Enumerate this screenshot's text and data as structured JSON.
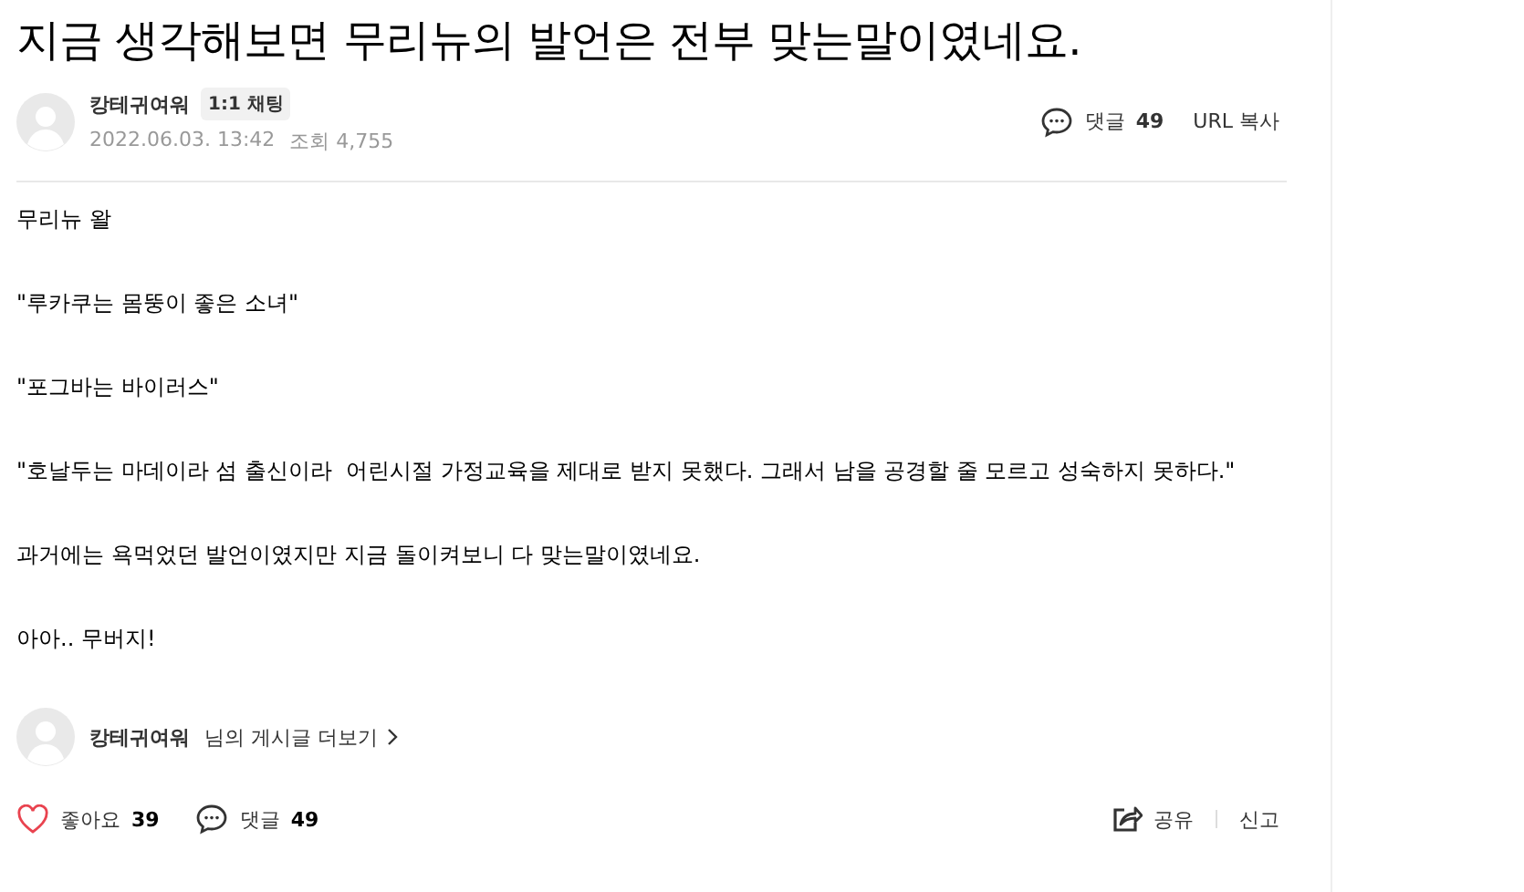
{
  "title": "지금 생각해보면 무리뉴의 발언은 전부 맞는말이였네요.",
  "author": {
    "name": "캉테귀여워",
    "chat_label": "1:1 채팅",
    "date": "2022.06.03. 13:42",
    "views": "조회 4,755"
  },
  "header_actions": {
    "comment_label": "댓글",
    "comment_count": "49",
    "url_copy": "URL 복사"
  },
  "body": [
    "무리뉴 왈",
    "\"루카쿠는 몸뚱이 좋은 소녀\"",
    "\"포그바는 바이러스\"",
    "\"호날두는 마데이라 섬 출신이라  어린시절 가정교육을 제대로 받지 못했다. 그래서 남을 공경할 줄 모르고 성숙하지 못하다.\"",
    "과거에는 욕먹었던 발언이였지만 지금 돌이켜보니 다 맞는말이였네요.",
    "아아.. 무버지!"
  ],
  "more_posts": {
    "name": "캉테귀여워",
    "suffix": "님의 게시글 더보기"
  },
  "footer": {
    "like_label": "좋아요",
    "like_count": "39",
    "liked": false,
    "comment_label": "댓글",
    "comment_count": "49",
    "share": "공유",
    "report": "신고"
  }
}
